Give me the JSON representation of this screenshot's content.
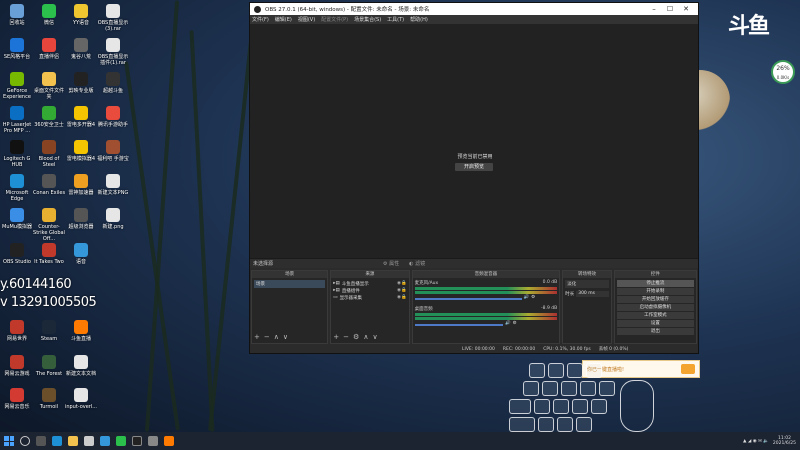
{
  "desktop": {
    "icons": [
      {
        "label": "回收站",
        "color": "#6aa0d8"
      },
      {
        "label": "微信",
        "color": "#2bbf4c"
      },
      {
        "label": "YY语音",
        "color": "#f0c630"
      },
      {
        "label": "OBS直播显示(3).rar",
        "color": "#e6e6e6"
      },
      {
        "label": "SE风格平台",
        "color": "#1d74d8"
      },
      {
        "label": "直播伴侣",
        "color": "#e8453c"
      },
      {
        "label": "鬼谷八荒",
        "color": "#666666"
      },
      {
        "label": "OBS直播显示插件(1).rar",
        "color": "#e6e6e6"
      },
      {
        "label": "GeForce Experience",
        "color": "#76b900"
      },
      {
        "label": "桌面文件文件夹",
        "color": "#f2c14e"
      },
      {
        "label": "剪映专业版",
        "color": "#222222"
      },
      {
        "label": "超越斗鱼",
        "color": "#333333"
      },
      {
        "label": "HP LaserJet Pro MFP ...",
        "color": "#0a6fc2"
      },
      {
        "label": "360安全卫士",
        "color": "#33aa33"
      },
      {
        "label": "雷电多开器4",
        "color": "#f5c400"
      },
      {
        "label": "腾讯手游助手",
        "color": "#e94b3c"
      },
      {
        "label": "Logitech G HUB",
        "color": "#111111"
      },
      {
        "label": "Blood of Steel",
        "color": "#884422"
      },
      {
        "label": "雷电模拟器4",
        "color": "#f5c400"
      },
      {
        "label": "福利吧 手游宝",
        "color": "#a05030"
      },
      {
        "label": "Microsoft Edge",
        "color": "#1e90d6"
      },
      {
        "label": "Conan Exiles",
        "color": "#555555"
      },
      {
        "label": "雷神加速器",
        "color": "#f0a020"
      },
      {
        "label": "新建文本PNG",
        "color": "#e6e6e6"
      },
      {
        "label": "MuMu模拟器",
        "color": "#3a8ee6"
      },
      {
        "label": "Counter-Strike Global Off...",
        "color": "#e8b030"
      },
      {
        "label": "超级浏览器",
        "color": "#555555"
      },
      {
        "label": "新建.png",
        "color": "#e6e6e6"
      },
      {
        "label": "OBS Studio",
        "color": "#222222"
      },
      {
        "label": "It Takes Two",
        "color": "#c0392b"
      },
      {
        "label": "语音",
        "color": "#3498db"
      },
      {
        "label": "网易世界",
        "color": "#c0392b"
      },
      {
        "label": "Steam",
        "color": "#1b2838"
      },
      {
        "label": "斗鱼直播",
        "color": "#ff7a00"
      },
      {
        "label": "网易云游戏",
        "color": "#c0392b"
      },
      {
        "label": "The Forest",
        "color": "#355e3b"
      },
      {
        "label": "新建文本文档",
        "color": "#e6e6e6"
      },
      {
        "label": "网易云音乐",
        "color": "#d33a31"
      },
      {
        "label": "Turmoil",
        "color": "#6b4f2b"
      },
      {
        "label": "input-overl...",
        "color": "#e6e6e6"
      }
    ]
  },
  "overlay": {
    "line1": "y.60144160",
    "line2": "v 13291005505"
  },
  "douyu": {
    "logo": "斗鱼"
  },
  "cpu_widget": {
    "percent": "26%",
    "sub": "0.0K/s"
  },
  "obs": {
    "title": "OBS 27.0.1 (64-bit, windows) - 配置文件: 未命名 - 场景: 未命名",
    "menu": [
      "文件(F)",
      "编辑(E)",
      "视图(V)",
      "配置文件(P)",
      "场景集合(S)",
      "工具(T)",
      "帮助(H)"
    ],
    "preview_text": "预览当前已禁用",
    "preview_button": "开启预览",
    "source_bar": {
      "label": "未选择源",
      "props": "属性",
      "filters": "滤镜"
    },
    "scenes": {
      "header": "场景",
      "items": [
        "场景"
      ]
    },
    "sources": {
      "header": "来源",
      "items": [
        "斗鱼直播显示",
        "直播组件",
        "显示器采集"
      ]
    },
    "mixer": {
      "header": "音频混音器",
      "channels": [
        {
          "name": "麦克风/Aux",
          "db": "0.0 dB"
        },
        {
          "name": "桌面音频",
          "db": "-8.9 dB"
        }
      ]
    },
    "transitions": {
      "header": "转场特效",
      "type": "淡化",
      "duration_label": "时长",
      "duration": "300 ms"
    },
    "controls": {
      "header": "控件",
      "buttons": [
        "停止推流",
        "开始录制",
        "开始回放缓存",
        "启动虚拟摄像机",
        "工作室模式",
        "设置",
        "退出"
      ]
    },
    "status": {
      "live": "LIVE: 00:00:00",
      "rec": "REC: 00:00:00",
      "cpu": "CPU: 0.1%, 30.00 fps",
      "drops": "丢帧 0 (0.0%)"
    }
  },
  "popup": {
    "text": "你已一键直播啦!"
  },
  "taskbar": {
    "time": "11:02",
    "date": "2021/6/25"
  }
}
